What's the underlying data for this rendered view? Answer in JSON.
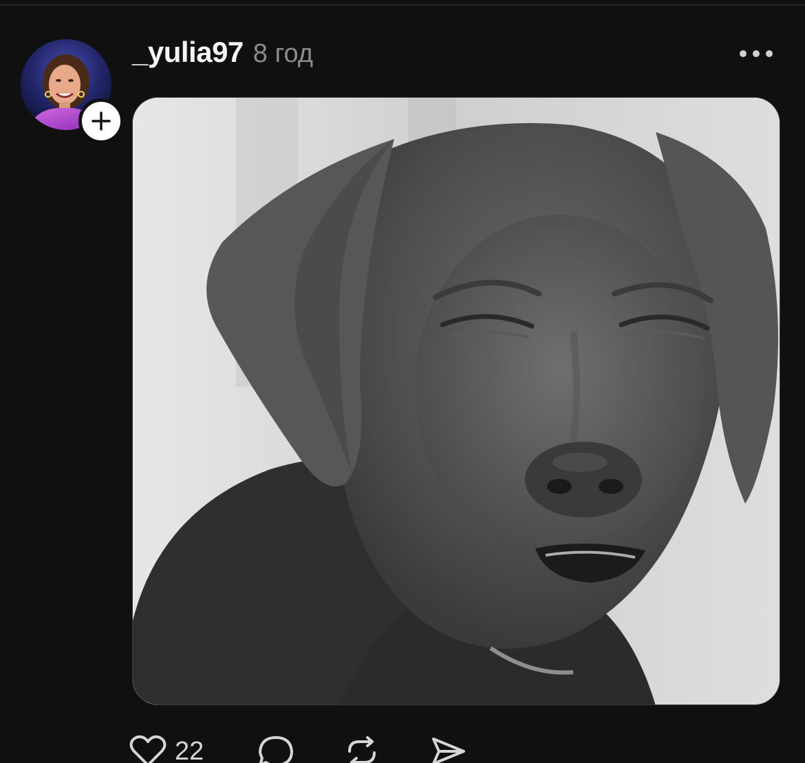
{
  "post": {
    "username": "_yulia97",
    "timestamp": "8 год",
    "like_count": "22"
  },
  "icons": {
    "more": "more-horizontal-icon",
    "follow": "plus-icon",
    "like": "heart-icon",
    "reply": "comment-icon",
    "repost": "repost-icon",
    "share": "send-icon"
  },
  "colors": {
    "background": "#101010",
    "text": "#f3f5f7",
    "secondary_text": "#8c8c8c"
  }
}
